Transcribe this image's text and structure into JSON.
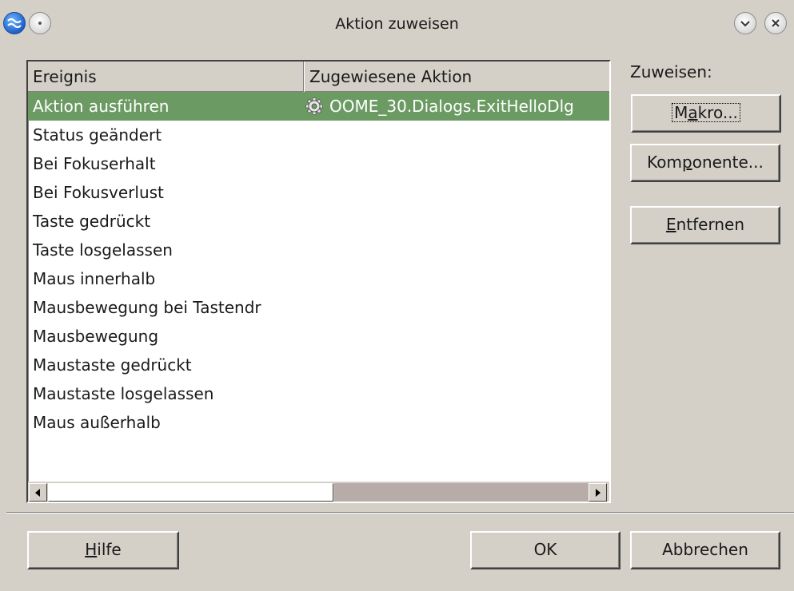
{
  "window": {
    "title": "Aktion zuweisen"
  },
  "list": {
    "columns": [
      "Ereignis",
      "Zugewiesene Aktion"
    ],
    "rows": [
      {
        "event": "Aktion ausführen",
        "action": "OOME_30.Dialogs.ExitHelloDlg",
        "selected": true,
        "icon": "gear-icon"
      },
      {
        "event": "Status geändert",
        "action": ""
      },
      {
        "event": "Bei Fokuserhalt",
        "action": ""
      },
      {
        "event": "Bei Fokusverlust",
        "action": ""
      },
      {
        "event": "Taste gedrückt",
        "action": ""
      },
      {
        "event": "Taste losgelassen",
        "action": ""
      },
      {
        "event": "Maus innerhalb",
        "action": ""
      },
      {
        "event": "Mausbewegung bei Tastendr",
        "action": ""
      },
      {
        "event": "Mausbewegung",
        "action": ""
      },
      {
        "event": "Maustaste gedrückt",
        "action": ""
      },
      {
        "event": "Maustaste losgelassen",
        "action": ""
      },
      {
        "event": "Maus außerhalb",
        "action": ""
      }
    ]
  },
  "assign": {
    "label": "Zuweisen:",
    "makro": {
      "pre": "M",
      "key": "a",
      "post": "kro..."
    },
    "komponente": {
      "pre": "Kom",
      "key": "p",
      "post": "onente..."
    },
    "entfernen": {
      "pre": "",
      "key": "E",
      "post": "ntfernen"
    }
  },
  "footer": {
    "hilfe": {
      "pre": "",
      "key": "H",
      "post": "ilfe"
    },
    "ok": "OK",
    "abbrechen": "Abbrechen"
  },
  "colors": {
    "selection": "#6b9b62",
    "dialog_bg": "#d4d0c8"
  }
}
